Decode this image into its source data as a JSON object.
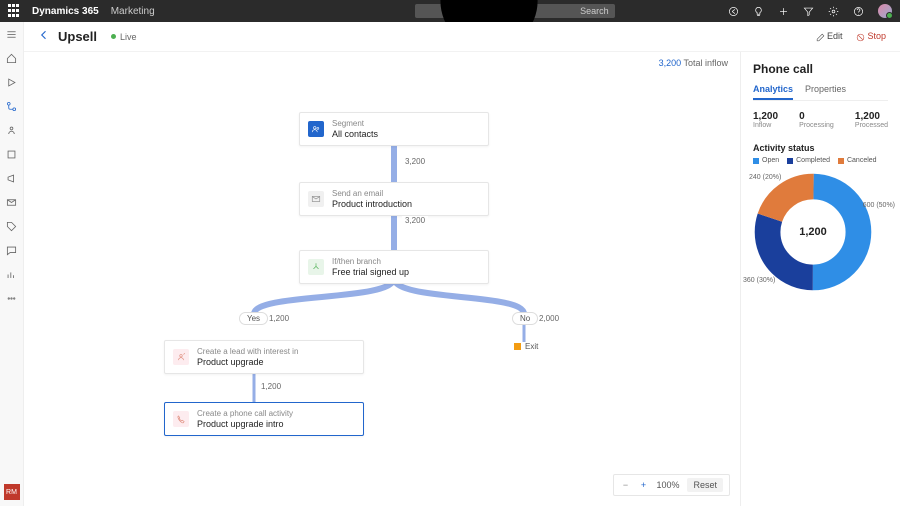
{
  "topbar": {
    "brand": "Dynamics 365",
    "module": "Marketing",
    "search_placeholder": "Search"
  },
  "header": {
    "title": "Upsell",
    "status": "Live",
    "edit": "Edit",
    "stop": "Stop"
  },
  "canvas": {
    "total_value": "3,200",
    "total_label": "Total inflow",
    "nodes": {
      "segment": {
        "label": "Segment",
        "title": "All contacts"
      },
      "email": {
        "label": "Send an email",
        "title": "Product introduction"
      },
      "branch": {
        "label": "If/then branch",
        "title": "Free trial signed up"
      },
      "lead": {
        "label": "Create a lead with interest in",
        "title": "Product upgrade"
      },
      "phone": {
        "label": "Create a phone call activity",
        "title": "Product upgrade intro"
      }
    },
    "edges": {
      "seg_email": "3,200",
      "email_branch": "3,200",
      "yes_pill": "Yes",
      "yes_count": "1,200",
      "no_pill": "No",
      "no_count": "2,000",
      "lead_phone": "1,200",
      "exit": "Exit"
    },
    "zoom": {
      "value": "100%",
      "reset": "Reset"
    }
  },
  "panel": {
    "title": "Phone call",
    "tabs": {
      "analytics": "Analytics",
      "properties": "Properties"
    },
    "stats": {
      "inflow": {
        "v": "1,200",
        "l": "Inflow"
      },
      "processing": {
        "v": "0",
        "l": "Processing"
      },
      "processed": {
        "v": "1,200",
        "l": "Processed"
      }
    },
    "activity_heading": "Activity status",
    "legend": {
      "open": "Open",
      "completed": "Completed",
      "canceled": "Canceled"
    },
    "donut_labels": {
      "a": "600 (50%)",
      "b": "360 (30%)",
      "c": "240 (20%)"
    },
    "donut_center": "1,200"
  },
  "leftnav": {
    "badge": "RM"
  },
  "chart_data": {
    "type": "pie",
    "title": "Activity status",
    "categories": [
      "Open",
      "Completed",
      "Canceled"
    ],
    "values": [
      600,
      360,
      240
    ],
    "percentages": [
      50,
      30,
      20
    ],
    "total": 1200,
    "colors": [
      "#2f8ee6",
      "#1a3f9c",
      "#e07b3c"
    ]
  }
}
